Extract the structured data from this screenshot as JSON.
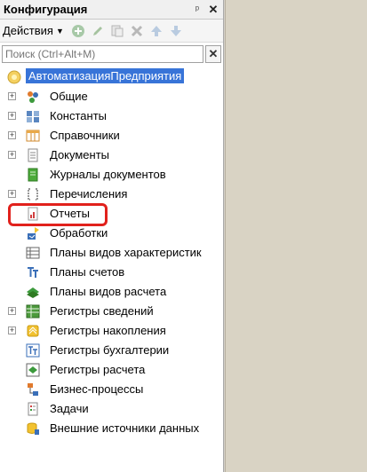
{
  "panel": {
    "title": "Конфигурация",
    "pin_glyph": "ᵖ",
    "close_glyph": "✕",
    "toolbar": {
      "actions_label": "Действия",
      "icons": [
        "add-icon",
        "edit-icon",
        "copy-icon",
        "delete-icon",
        "move-up-icon",
        "move-down-icon"
      ]
    },
    "search": {
      "placeholder": "Поиск (Ctrl+Alt+M)",
      "value": ""
    },
    "clear_glyph": "✕"
  },
  "tree": {
    "root": {
      "label": "АвтоматизацияПредприятия",
      "selected": true
    },
    "items": [
      {
        "label": "Общие",
        "expandable": true,
        "icon": "common-icon"
      },
      {
        "label": "Константы",
        "expandable": true,
        "icon": "constants-icon"
      },
      {
        "label": "Справочники",
        "expandable": true,
        "icon": "catalogs-icon"
      },
      {
        "label": "Документы",
        "expandable": true,
        "icon": "documents-icon"
      },
      {
        "label": "Журналы документов",
        "expandable": false,
        "icon": "document-journals-icon"
      },
      {
        "label": "Перечисления",
        "expandable": true,
        "icon": "enums-icon"
      },
      {
        "label": "Отчеты",
        "expandable": false,
        "icon": "reports-icon",
        "highlighted": true
      },
      {
        "label": "Обработки",
        "expandable": false,
        "icon": "data-processors-icon"
      },
      {
        "label": "Планы видов характеристик",
        "expandable": false,
        "icon": "chart-of-characteristic-types-icon"
      },
      {
        "label": "Планы счетов",
        "expandable": false,
        "icon": "chart-of-accounts-icon"
      },
      {
        "label": "Планы видов расчета",
        "expandable": false,
        "icon": "chart-of-calculation-types-icon"
      },
      {
        "label": "Регистры сведений",
        "expandable": true,
        "icon": "information-registers-icon"
      },
      {
        "label": "Регистры накопления",
        "expandable": true,
        "icon": "accumulation-registers-icon"
      },
      {
        "label": "Регистры бухгалтерии",
        "expandable": false,
        "icon": "accounting-registers-icon"
      },
      {
        "label": "Регистры расчета",
        "expandable": false,
        "icon": "calculation-registers-icon"
      },
      {
        "label": "Бизнес-процессы",
        "expandable": false,
        "icon": "business-processes-icon"
      },
      {
        "label": "Задачи",
        "expandable": false,
        "icon": "tasks-icon"
      },
      {
        "label": "Внешние источники данных",
        "expandable": false,
        "icon": "external-data-sources-icon"
      }
    ]
  },
  "colors": {
    "selection": "#3874d8",
    "highlight": "#e1211c",
    "right_area": "#d9d3c4"
  }
}
